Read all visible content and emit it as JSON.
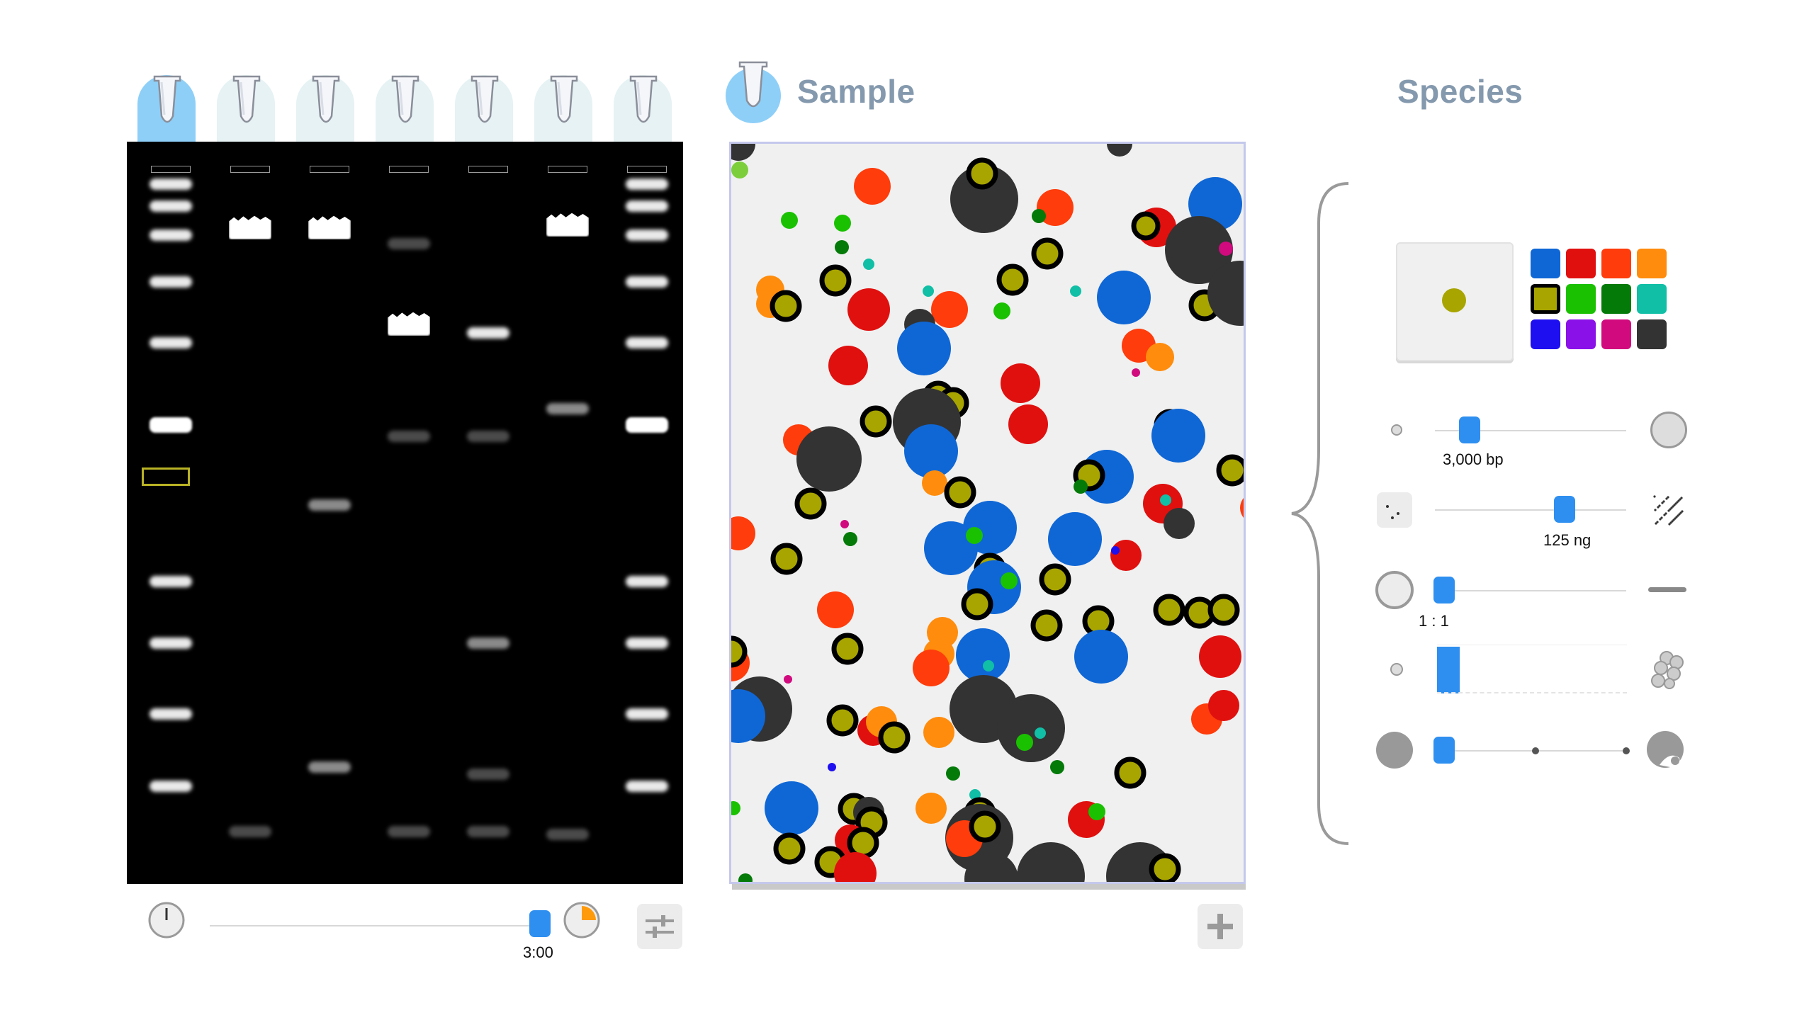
{
  "header": {
    "sample_title": "Sample",
    "species_title": "Species"
  },
  "lanes": [
    {
      "id": "ladder",
      "selected": true
    },
    {
      "id": "lane-2",
      "selected": false
    },
    {
      "id": "lane-3",
      "selected": false
    },
    {
      "id": "lane-4",
      "selected": false
    },
    {
      "id": "lane-5",
      "selected": false
    },
    {
      "id": "lane-6",
      "selected": false
    },
    {
      "id": "lane-7",
      "selected": false
    }
  ],
  "timer": {
    "value_label": "3:00",
    "progress": 0.92
  },
  "species": {
    "selected_color": "#a8a500",
    "palette": [
      "#0f67d6",
      "#e0100f",
      "#ff3c0b",
      "#ff8c0c",
      "#a8a500",
      "#1ac100",
      "#047a09",
      "#10bfa6",
      "#1e0ff0",
      "#8a11e8",
      "#d10a7e",
      "#333333"
    ],
    "length": {
      "label": "3,000 bp",
      "fraction": 0.15
    },
    "amount": {
      "label": "125 ng",
      "fraction": 0.71
    },
    "ratio": {
      "label": "1 : 1",
      "fraction": 0.0
    },
    "histogram": {
      "fraction": 0.12
    },
    "digest": {
      "fraction": 0.0
    }
  },
  "colors": {
    "accent": "#2e8ff0",
    "tube_selected": "#8ecff8",
    "tube_default": "#e6f2f3",
    "header_text": "#8499ad"
  },
  "icons": {
    "clock": "clock-icon",
    "timer": "timer-icon",
    "settings": "sliders-icon",
    "add": "plus-icon",
    "tube": "test-tube-icon"
  }
}
